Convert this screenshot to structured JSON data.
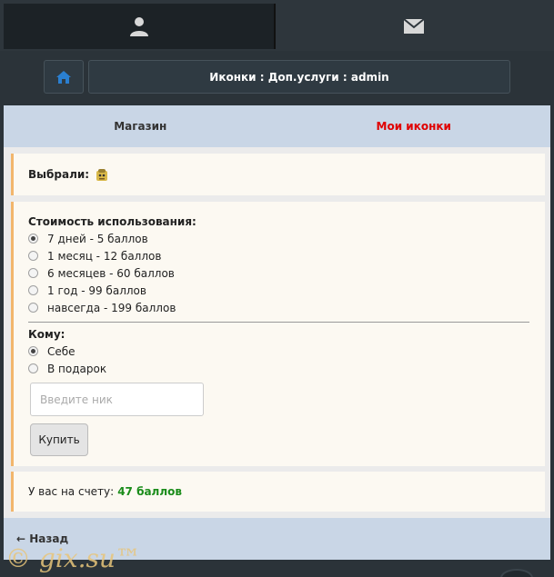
{
  "header": {
    "title": "Иконки : Доп.услуги : admin"
  },
  "subnav": {
    "shop": "Магазин",
    "mine": "Мои иконки"
  },
  "chosen": {
    "label": "Выбрали:"
  },
  "cost": {
    "label": "Стоимость использования:",
    "options": [
      "7 дней - 5 баллов",
      "1 месяц - 12 баллов",
      "6 месяцев - 60 баллов",
      "1 год - 99 баллов",
      "навсегда - 199 баллов"
    ],
    "selected": 0
  },
  "recipient": {
    "label": "Кому:",
    "options": [
      "Себе",
      "В подарок"
    ],
    "selected": 0,
    "nick_placeholder": "Введите ник"
  },
  "buy_label": "Купить",
  "account": {
    "label": "У вас на счету:",
    "value": "47 баллов"
  },
  "back_label": "← Назад",
  "watermark": "© gix.su™",
  "colors": {
    "accent_red": "#e00000",
    "balance_green": "#1a8c1a",
    "home_icon": "#2a7fd0",
    "block_border": "#f2b66c"
  }
}
